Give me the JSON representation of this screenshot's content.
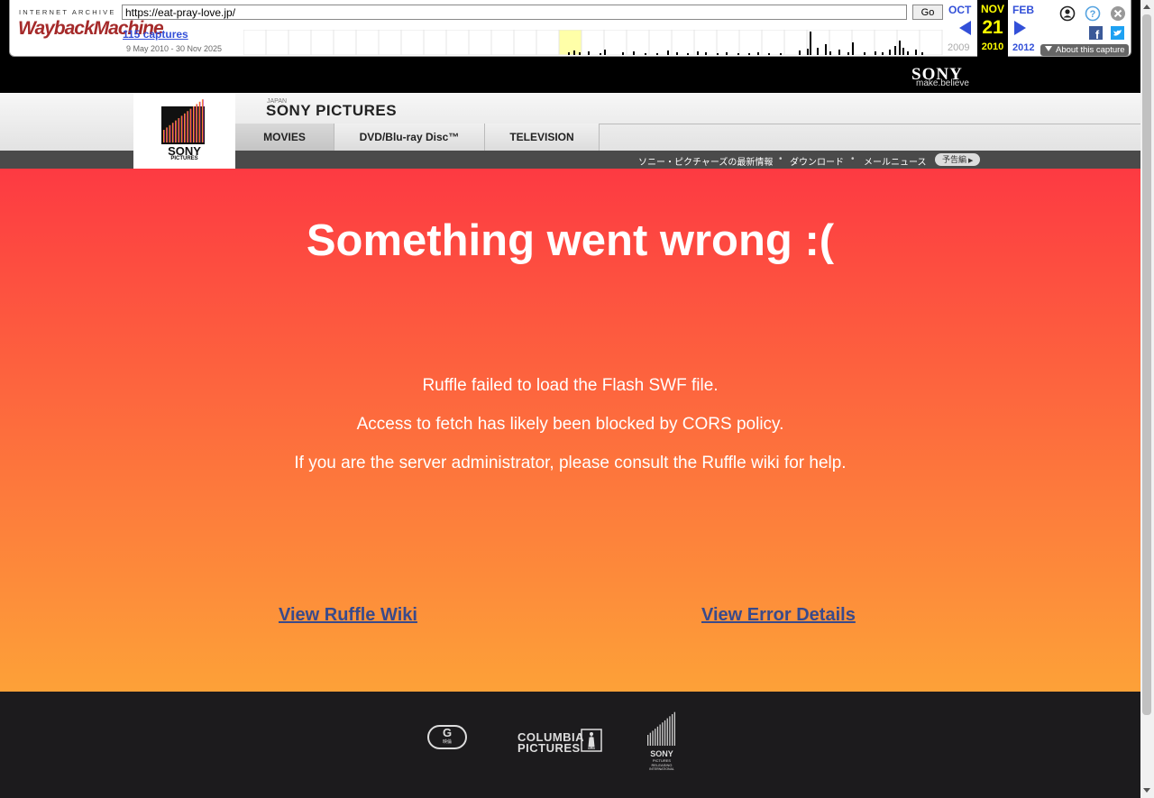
{
  "wayback": {
    "logo_top": "INTERNET ARCHIVE",
    "logo_main": "WaybackMachine",
    "url": "https://eat-pray-love.jp/",
    "go_label": "Go",
    "captures": "115 captures",
    "range": "9 May 2010 - 30 Nov 2025",
    "prev_month": "OCT",
    "cur_month": "NOV",
    "next_month": "FEB",
    "cur_day": "21",
    "prev_year": "2009",
    "cur_year": "2010",
    "next_year": "2012",
    "about_label": "About this capture",
    "icons": [
      "user-icon",
      "help-icon",
      "close-icon",
      "facebook-icon",
      "twitter-icon"
    ]
  },
  "sony": {
    "brand": "SONY",
    "tagline": "make.believe"
  },
  "header": {
    "logo_text": "SONY",
    "logo_sub": "PICTURES",
    "region": "JAPAN",
    "site_title": "SONY PICTURES",
    "tabs": [
      {
        "label": "MOVIES",
        "active": true
      },
      {
        "label": "DVD/Blu-ray Disc™",
        "active": false
      },
      {
        "label": "TELEVISION",
        "active": false
      }
    ],
    "subnav": [
      "ソニー・ピクチャーズの最新情報",
      "ダウンロード",
      "メールニュース"
    ],
    "trailer_label": "予告編"
  },
  "error": {
    "title": "Something went wrong :(",
    "lines": [
      "Ruffle failed to load the Flash SWF file.",
      "Access to fetch has likely been blocked by CORS policy.",
      "If you are the server administrator, please consult the Ruffle wiki for help."
    ],
    "wiki_link": "View Ruffle Wiki",
    "details_link": "View Error Details"
  },
  "footer": {
    "rating_letter": "G",
    "rating_sub": "映倫",
    "columbia": "COLUMBIA PICTURES",
    "columbia_line1": "COLUMBIA",
    "columbia_line2": "PICTURES",
    "spr_line1": "SONY",
    "spr_line2": "PICTURES",
    "spr_line3": "RELEASING",
    "spr_line4": "INTERNATIONAL"
  },
  "colors": {
    "error_gradient_top": "#fd3a42",
    "error_gradient_bottom": "#fda138",
    "link_color": "#3a4a8a",
    "wayback_blue": "#3350d8",
    "footer_bg": "#1c1b1d"
  }
}
